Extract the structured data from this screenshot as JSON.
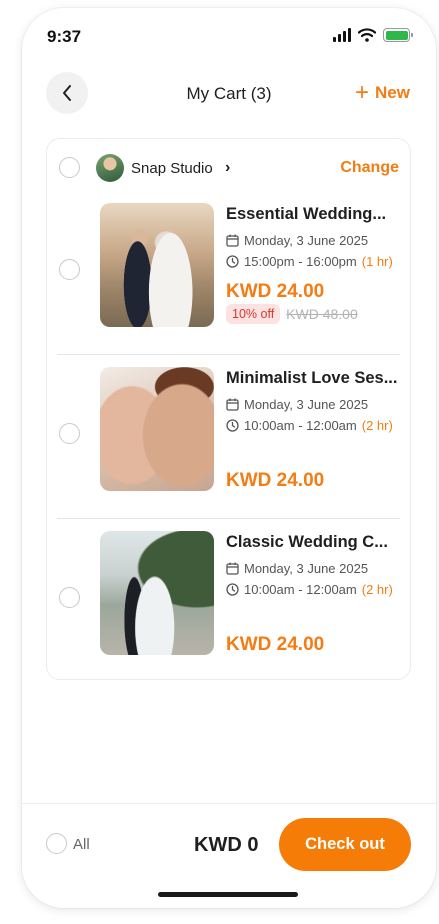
{
  "status_bar": {
    "time": "9:37"
  },
  "header": {
    "title": "My Cart (3)",
    "new_label": "New"
  },
  "studio": {
    "name": "Snap Studio",
    "change_label": "Change"
  },
  "items": [
    {
      "name": "Essential Wedding...",
      "date": "Monday, 3 June 2025",
      "time": "15:00pm - 16:00pm",
      "duration": "(1 hr)",
      "price": "KWD 24.00",
      "discount": "10% off",
      "original_price": "KWD 48.00"
    },
    {
      "name": "Minimalist Love Ses...",
      "date": "Monday, 3 June 2025",
      "time": "10:00am - 12:00am",
      "duration": "(2 hr)",
      "price": "KWD 24.00"
    },
    {
      "name": "Classic Wedding C...",
      "date": "Monday, 3 June 2025",
      "time": "10:00am - 12:00am",
      "duration": "(2 hr)",
      "price": "KWD 24.00"
    }
  ],
  "footer": {
    "select_all_label": "All",
    "total": "KWD 0",
    "checkout_label": "Check out"
  },
  "colors": {
    "accent": "#f47c12",
    "discount_bg": "#fde2e2",
    "discount_text": "#d33a2f"
  }
}
